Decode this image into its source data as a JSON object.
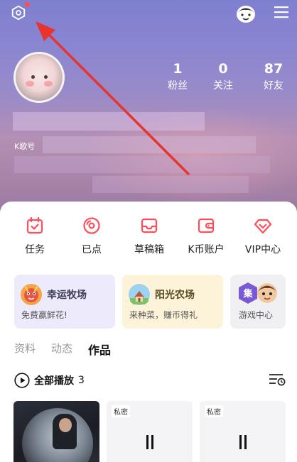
{
  "header": {
    "stats": [
      {
        "value": "1",
        "label": "粉丝"
      },
      {
        "value": "0",
        "label": "关注"
      },
      {
        "value": "87",
        "label": "好友"
      }
    ],
    "k_id_prefix": "K歌号"
  },
  "quick_actions": [
    {
      "label": "任务",
      "icon": "calendar-check-icon"
    },
    {
      "label": "已点",
      "icon": "disc-icon"
    },
    {
      "label": "草稿箱",
      "icon": "inbox-icon"
    },
    {
      "label": "K币账户",
      "icon": "wallet-icon"
    },
    {
      "label": "VIP中心",
      "icon": "diamond-icon"
    }
  ],
  "cards": [
    {
      "title": "幸运牧场",
      "subtitle": "免费赢鲜花!"
    },
    {
      "title": "阳光农场",
      "subtitle": "来种菜，赚币得礼"
    },
    {
      "title": "",
      "subtitle": "游戏中心",
      "badge": "集"
    }
  ],
  "tabs": [
    {
      "label": "资料",
      "active": false
    },
    {
      "label": "动态",
      "active": false
    },
    {
      "label": "作品",
      "active": true
    }
  ],
  "play_all": {
    "label": "全部播放",
    "count": "3"
  },
  "works": [
    {
      "tag": "",
      "type": "photo"
    },
    {
      "tag": "私密",
      "type": "plain"
    },
    {
      "tag": "私密",
      "type": "plain"
    }
  ],
  "colors": {
    "accent": "#ff4d5a",
    "card_lavender": "#eceafb",
    "card_yellow": "#fdf3d8",
    "card_gray": "#f0f0f2"
  }
}
